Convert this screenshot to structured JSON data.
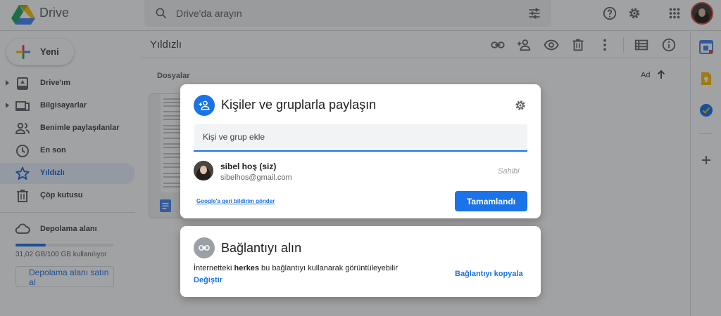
{
  "app": {
    "name": "Drive"
  },
  "search": {
    "placeholder": "Drive'da arayın"
  },
  "sidebar": {
    "new_label": "Yeni",
    "items": [
      {
        "label": "Drive'ım",
        "icon": "my-drive-icon",
        "expandable": true
      },
      {
        "label": "Bilgisayarlar",
        "icon": "computers-icon",
        "expandable": true
      },
      {
        "label": "Benimle paylaşılanlar",
        "icon": "shared-icon",
        "expandable": false
      },
      {
        "label": "En son",
        "icon": "recent-icon",
        "expandable": false
      },
      {
        "label": "Yıldızlı",
        "icon": "star-icon",
        "expandable": false,
        "active": true
      },
      {
        "label": "Çöp kutusu",
        "icon": "trash-icon",
        "expandable": false
      }
    ],
    "storage": {
      "label": "Depolama alanı",
      "usage": "31,02 GB/100 GB kullanılıyor",
      "used_fraction": 0.31,
      "buy_label": "Depolama alanı satın al"
    }
  },
  "main": {
    "title": "Yıldızlı",
    "section_label": "Dosyalar",
    "sort_label": "Ad"
  },
  "share_dialog": {
    "title": "Kişiler ve gruplarla paylaşın",
    "add_placeholder": "Kişi ve grup ekle",
    "person": {
      "name": "sibel hoş (siz)",
      "email": "sibelhos@gmail.com",
      "role": "Sahibi"
    },
    "feedback_link": "Google'a geri bildirim gönder",
    "done_label": "Tamamlandı"
  },
  "link_dialog": {
    "title": "Bağlantıyı alın",
    "desc_prefix": "İnternetteki ",
    "desc_bold": "herkes",
    "desc_suffix": " bu bağlantıyı kullanarak görüntüleyebilir",
    "change_label": "Değiştir",
    "copy_label": "Bağlantıyı kopyala"
  },
  "colors": {
    "accent": "#1a73e8",
    "active_bg": "#e8f0fe",
    "overlay": "rgba(32,33,36,0.42)"
  }
}
